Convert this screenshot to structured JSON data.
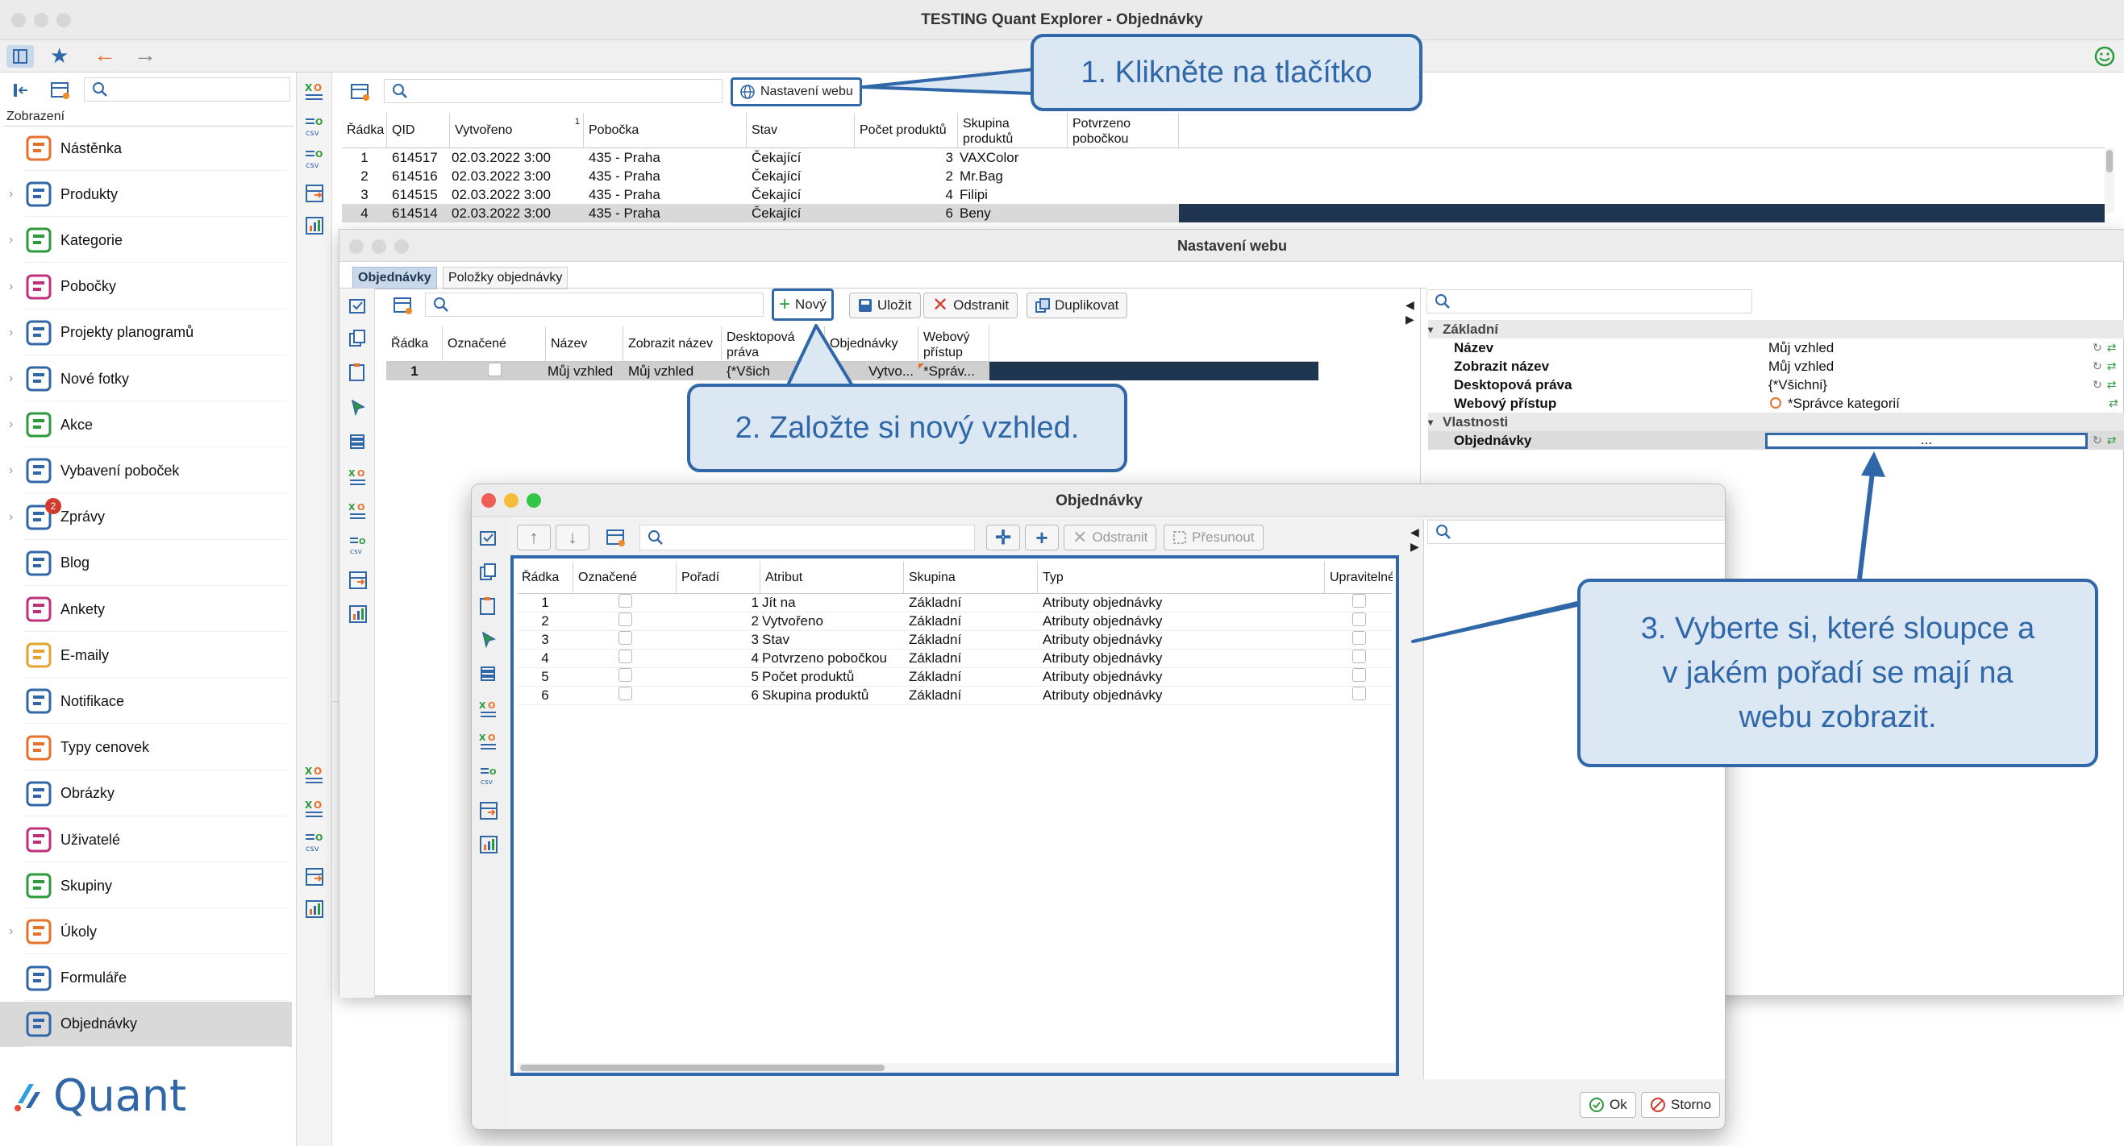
{
  "window": {
    "title": "TESTING Quant Explorer - Objednávky"
  },
  "sidebar": {
    "search_placeholder": "",
    "section_label": "Zobrazení",
    "items": [
      {
        "label": "Nástěnka",
        "icon": "dashboard-icon",
        "chev": false
      },
      {
        "label": "Produkty",
        "icon": "products-icon",
        "chev": true
      },
      {
        "label": "Kategorie",
        "icon": "categories-icon",
        "chev": true
      },
      {
        "label": "Pobočky",
        "icon": "branches-icon",
        "chev": true
      },
      {
        "label": "Projekty planogramů",
        "icon": "planogram-icon",
        "chev": true
      },
      {
        "label": "Nové fotky",
        "icon": "camera-icon",
        "chev": true
      },
      {
        "label": "Akce",
        "icon": "clock-icon",
        "chev": true
      },
      {
        "label": "Vybavení poboček",
        "icon": "equipment-icon",
        "chev": true
      },
      {
        "label": "Zprávy",
        "icon": "messages-icon",
        "chev": true,
        "badge": "2"
      },
      {
        "label": "Blog",
        "icon": "blog-icon",
        "chev": false
      },
      {
        "label": "Ankety",
        "icon": "survey-icon",
        "chev": false
      },
      {
        "label": "E-maily",
        "icon": "email-icon",
        "chev": false
      },
      {
        "label": "Notifikace",
        "icon": "notification-icon",
        "chev": false
      },
      {
        "label": "Typy cenovek",
        "icon": "price-tag-icon",
        "chev": false
      },
      {
        "label": "Obrázky",
        "icon": "image-icon",
        "chev": false
      },
      {
        "label": "Uživatelé",
        "icon": "user-icon",
        "chev": false
      },
      {
        "label": "Skupiny",
        "icon": "group-icon",
        "chev": false
      },
      {
        "label": "Úkoly",
        "icon": "task-icon",
        "chev": true
      },
      {
        "label": "Formuláře",
        "icon": "form-icon",
        "chev": false
      },
      {
        "label": "Objednávky",
        "icon": "orders-icon",
        "chev": false
      }
    ],
    "logo": "Quant"
  },
  "main": {
    "settings_button": "Nastavení webu",
    "columns": [
      "Řádka",
      "QID",
      "Vytvořeno",
      "Pobočka",
      "Stav",
      "Počet produktů",
      "Skupina produktů",
      "Potvrzeno pobočkou"
    ],
    "rows": [
      {
        "n": "1",
        "qid": "614517",
        "created": "02.03.2022 3:00",
        "branch": "435 - Praha",
        "state": "Čekající",
        "count": "3",
        "group": "VAXColor"
      },
      {
        "n": "2",
        "qid": "614516",
        "created": "02.03.2022 3:00",
        "branch": "435 - Praha",
        "state": "Čekající",
        "count": "2",
        "group": "Mr.Bag"
      },
      {
        "n": "3",
        "qid": "614515",
        "created": "02.03.2022 3:00",
        "branch": "435 - Praha",
        "state": "Čekající",
        "count": "4",
        "group": "Filipi"
      },
      {
        "n": "4",
        "qid": "614514",
        "created": "02.03.2022 3:00",
        "branch": "435 - Praha",
        "state": "Čekající",
        "count": "6",
        "group": "Beny"
      }
    ],
    "sort_indicator": "1"
  },
  "settings_dialog": {
    "title": "Nastavení webu",
    "tabs": [
      "Objednávky",
      "Položky objednávky"
    ],
    "toolbar": {
      "new": "Nový",
      "save": "Uložit",
      "remove": "Odstranit",
      "duplicate": "Duplikovat"
    },
    "columns": [
      "Řádka",
      "Označené",
      "Název",
      "Zobrazit název",
      "Desktopová práva",
      "Objednávky",
      "Webový přístup"
    ],
    "row": {
      "n": "1",
      "name": "Můj vzhled",
      "display": "Můj vzhled",
      "rights": "{*Všich",
      "orders": "Vytvo...",
      "web": "*Správ..."
    },
    "props": {
      "group1": "Základní",
      "group2": "Vlastnosti",
      "items": [
        {
          "k": "Název",
          "v": "Můj vzhled"
        },
        {
          "k": "Zobrazit název",
          "v": "Můj vzhled"
        },
        {
          "k": "Desktopová práva",
          "v": "{*Všichni}"
        },
        {
          "k": "Webový přístup",
          "v": "*Správce kategorií"
        }
      ],
      "orders_key": "Objednávky",
      "orders_value": "..."
    }
  },
  "orders_dialog": {
    "title": "Objednávky",
    "toolbar": {
      "remove": "Odstranit",
      "move": "Přesunout"
    },
    "columns": [
      "Řádka",
      "Označené",
      "Pořadí",
      "Atribut",
      "Skupina",
      "Typ",
      "Upravitelné"
    ],
    "rows": [
      {
        "n": "1",
        "order": "1",
        "attr": "Jít na",
        "group": "Základní",
        "type": "Atributy objednávky"
      },
      {
        "n": "2",
        "order": "2",
        "attr": "Vytvořeno",
        "group": "Základní",
        "type": "Atributy objednávky"
      },
      {
        "n": "3",
        "order": "3",
        "attr": "Stav",
        "group": "Základní",
        "type": "Atributy objednávky"
      },
      {
        "n": "4",
        "order": "4",
        "attr": "Potvrzeno pobočkou",
        "group": "Základní",
        "type": "Atributy objednávky"
      },
      {
        "n": "5",
        "order": "5",
        "attr": "Počet produktů",
        "group": "Základní",
        "type": "Atributy objednávky"
      },
      {
        "n": "6",
        "order": "6",
        "attr": "Skupina produktů",
        "group": "Základní",
        "type": "Atributy objednávky"
      }
    ],
    "ok": "Ok",
    "cancel": "Storno"
  },
  "callouts": {
    "c1": "1. Klikněte na tlačítko",
    "c2": "2. Založte si nový vzhled.",
    "c3_l1": "3. Vyberte si, které sloupce a",
    "c3_l2": "v jakém pořadí se mají na",
    "c3_l3": "webu zobrazit."
  },
  "colors": {
    "accent": "#2f67a8",
    "selection": "#1f3550",
    "callout_bg": "#dbe7f3"
  }
}
